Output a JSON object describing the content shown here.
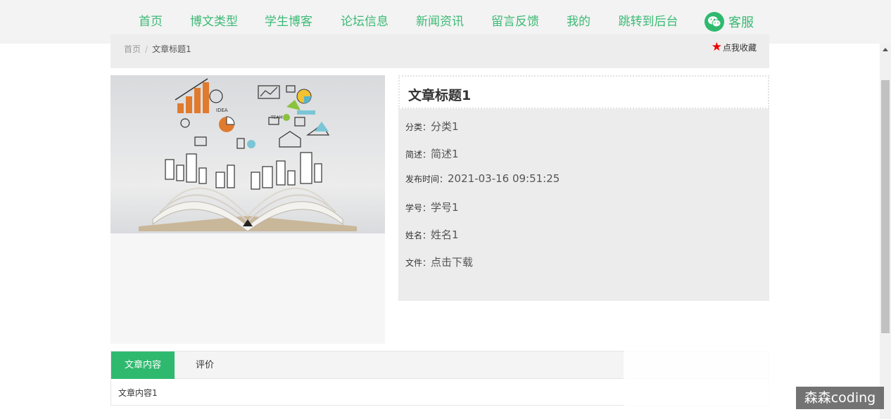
{
  "nav": {
    "items": [
      {
        "label": "首页"
      },
      {
        "label": "博文类型"
      },
      {
        "label": "学生博客"
      },
      {
        "label": "论坛信息"
      },
      {
        "label": "新闻资讯"
      },
      {
        "label": "留言反馈"
      },
      {
        "label": "我的"
      },
      {
        "label": "跳转到后台"
      }
    ],
    "active_index": 2,
    "service_label": "客服"
  },
  "breadcrumb": {
    "home": "首页",
    "separator": "/",
    "current": "文章标题1"
  },
  "favorite_label": "点我收藏",
  "article": {
    "title": "文章标题1",
    "fields": [
      {
        "label": "分类：",
        "value": "分类1"
      },
      {
        "label": "简述：",
        "value": "简述1"
      },
      {
        "label": "发布时间：",
        "value": "2021-03-16 09:51:25"
      },
      {
        "label": "学号：",
        "value": "学号1"
      },
      {
        "label": "姓名：",
        "value": "姓名1"
      },
      {
        "label": "文件：",
        "value": "点击下载"
      }
    ]
  },
  "tabs": {
    "items": [
      {
        "label": "文章内容"
      },
      {
        "label": "评价"
      }
    ],
    "content": "文章内容1"
  },
  "watermark": "森森coding",
  "colors": {
    "accent": "#2fb96f",
    "nav_text": "#3cba75",
    "favorite_star": "#e00000"
  }
}
